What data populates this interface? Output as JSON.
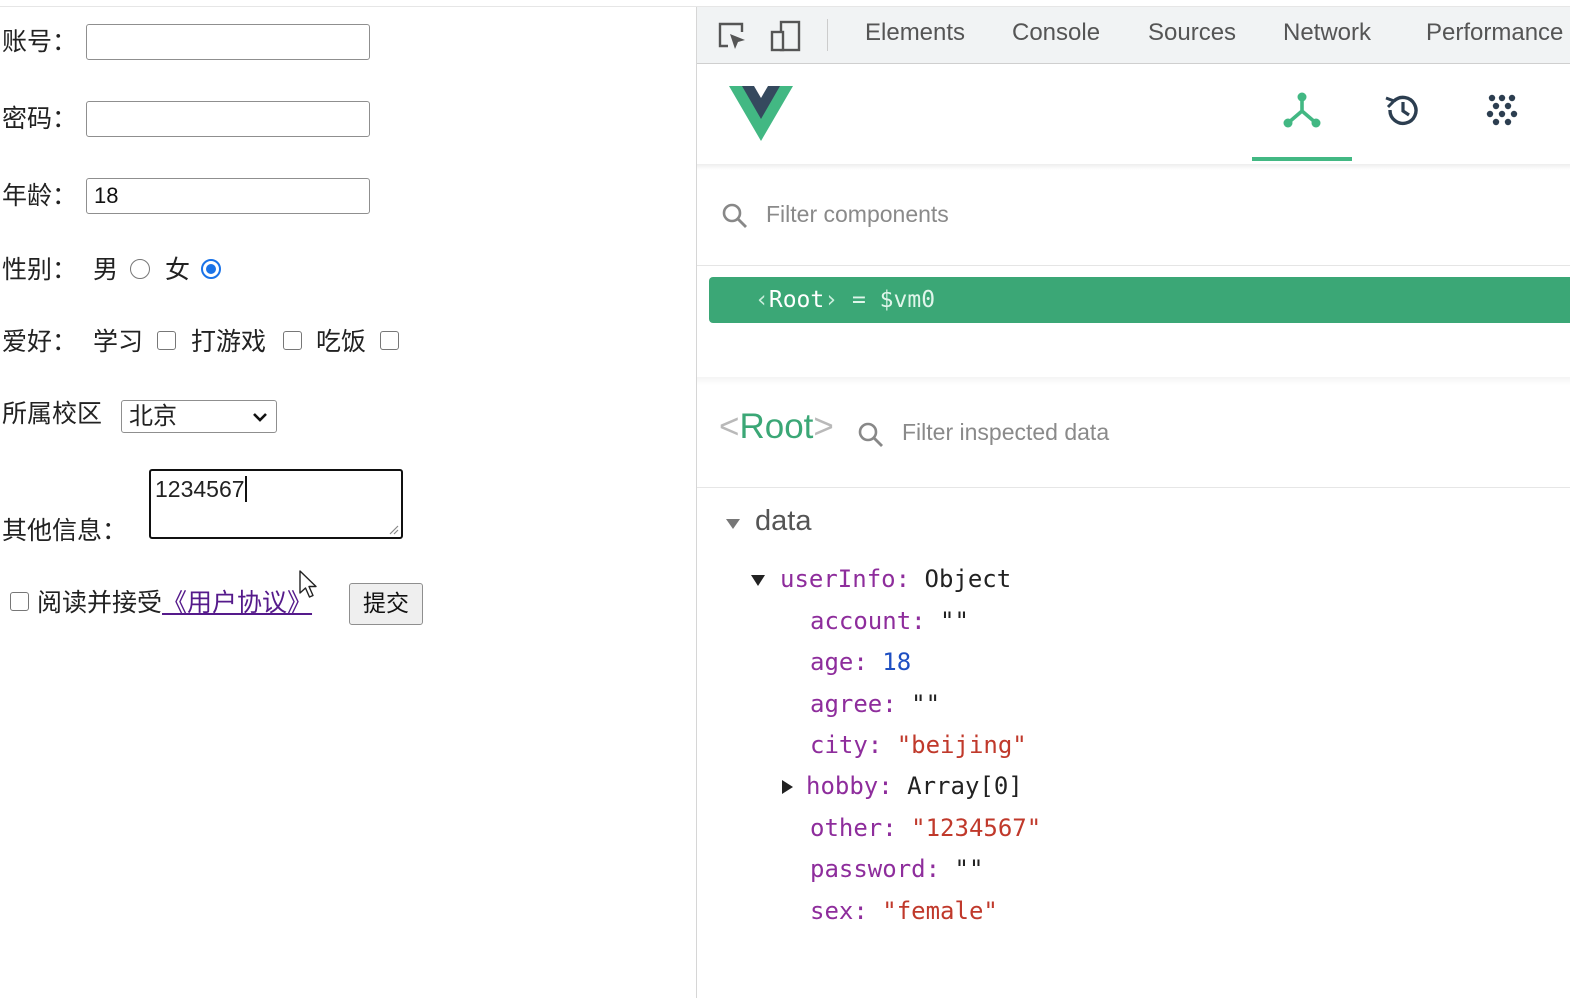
{
  "form": {
    "account_label": "账号：",
    "account_value": "",
    "password_label": "密码：",
    "password_value": "",
    "age_label": "年龄：",
    "age_value": "18",
    "sex_label": "性别：",
    "sex_male": "男",
    "sex_female": "女",
    "sex_selected": "female",
    "hobby_label": "爱好：",
    "hobby_options": [
      "学习",
      "打游戏",
      "吃饭"
    ],
    "campus_label": "所属校区",
    "campus_selected": "北京",
    "other_label": "其他信息：",
    "other_value": "1234567",
    "agree_text": "阅读并接受",
    "agreement_link": "《用户协议》",
    "submit_label": "提交"
  },
  "devtools": {
    "tabs": [
      "Elements",
      "Console",
      "Sources",
      "Network",
      "Performance"
    ],
    "filter_components_placeholder": "Filter components",
    "root_open": "‹",
    "root_name": "Root",
    "root_close": "›",
    "root_assign": "= $vm0",
    "inspected_open": "<",
    "inspected_name": "Root",
    "inspected_close": ">",
    "filter_inspected_placeholder": "Filter inspected data",
    "section": "data",
    "object_key": "userInfo:",
    "object_type": "Object",
    "fields": {
      "account_key": "account:",
      "account_val": "\"\"",
      "age_key": "age:",
      "age_val": "18",
      "agree_key": "agree:",
      "agree_val": "\"\"",
      "city_key": "city:",
      "city_val": "\"beijing\"",
      "hobby_key": "hobby:",
      "hobby_val": "Array[0]",
      "other_key": "other:",
      "other_val": "\"1234567\"",
      "password_key": "password:",
      "password_val": "\"\"",
      "sex_key": "sex:",
      "sex_val": "\"female\""
    },
    "accent": "#42b883",
    "selection_bg": "#3ba776"
  }
}
